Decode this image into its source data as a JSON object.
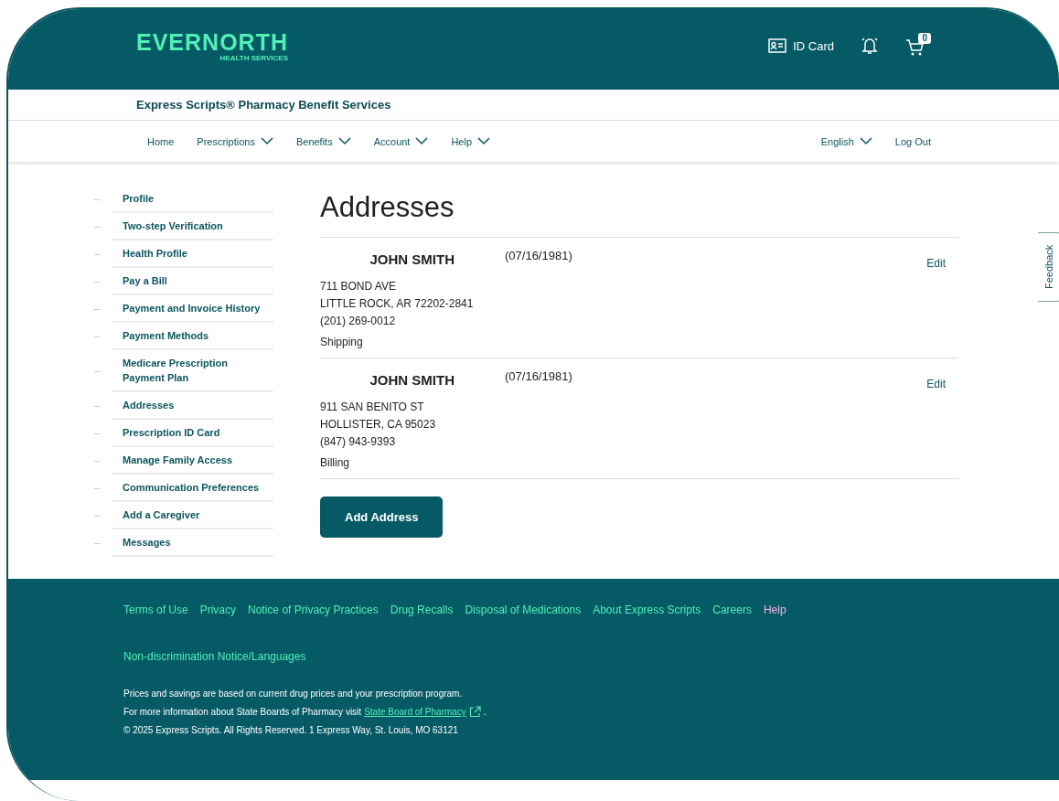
{
  "header": {
    "logo": "EVERNORTH",
    "logo_sub": "HEALTH SERVICES",
    "id_card": "ID Card",
    "cart_count": "0"
  },
  "brand_bar": {
    "title": "Express Scripts® Pharmacy Benefit Services"
  },
  "nav": {
    "items": [
      {
        "label": "Home",
        "dropdown": false
      },
      {
        "label": "Prescriptions",
        "dropdown": true
      },
      {
        "label": "Benefits",
        "dropdown": true
      },
      {
        "label": "Account",
        "dropdown": true
      },
      {
        "label": "Help",
        "dropdown": true
      }
    ],
    "right": [
      {
        "label": "English",
        "dropdown": true
      },
      {
        "label": "Log Out",
        "dropdown": false
      }
    ]
  },
  "sidebar": {
    "items": [
      "Profile",
      "Two-step Verification",
      "Health Profile",
      "Pay a Bill",
      "Payment and Invoice History",
      "Payment Methods",
      "Medicare Prescription Payment Plan",
      "Addresses",
      "Prescription ID Card",
      "Manage Family Access",
      "Communication Preferences",
      "Add a Caregiver",
      "Messages"
    ]
  },
  "main": {
    "title": "Addresses",
    "addresses": [
      {
        "name": "JOHN SMITH",
        "dob": "(07/16/1981)",
        "lines": [
          "711 BOND AVE",
          "LITTLE ROCK, AR 72202-2841",
          "(201) 269-0012"
        ],
        "type": "Shipping",
        "action": "Edit"
      },
      {
        "name": "JOHN SMITH",
        "dob": "(07/16/1981)",
        "lines": [
          "911 SAN BENITO ST",
          "HOLLISTER, CA 95023",
          "(847) 943-9393"
        ],
        "type": "Billing",
        "action": "Edit"
      }
    ],
    "add_button": "Add Address"
  },
  "feedback_tab": "Feedback",
  "footer": {
    "links": [
      {
        "label": "Terms of Use",
        "visited": false
      },
      {
        "label": "Privacy",
        "visited": false
      },
      {
        "label": "Notice of Privacy Practices",
        "visited": false
      },
      {
        "label": "Drug Recalls",
        "visited": false
      },
      {
        "label": "Disposal of Medications",
        "visited": false
      },
      {
        "label": "About Express Scripts",
        "visited": false
      },
      {
        "label": "Careers",
        "visited": false
      },
      {
        "label": "Help",
        "visited": true
      }
    ],
    "link2": "Non-discrimination Notice/Languages",
    "note1": "Prices and savings are based on current drug prices and your prescription program.",
    "note2": "For more information about State Boards of Pharmacy visit",
    "note2_link": "State Board of Pharmacy",
    "note2_end": ".",
    "copyright": "© 2025 Express Scripts. All Rights Reserved. 1 Express Way, St. Louis, MO 63121"
  }
}
